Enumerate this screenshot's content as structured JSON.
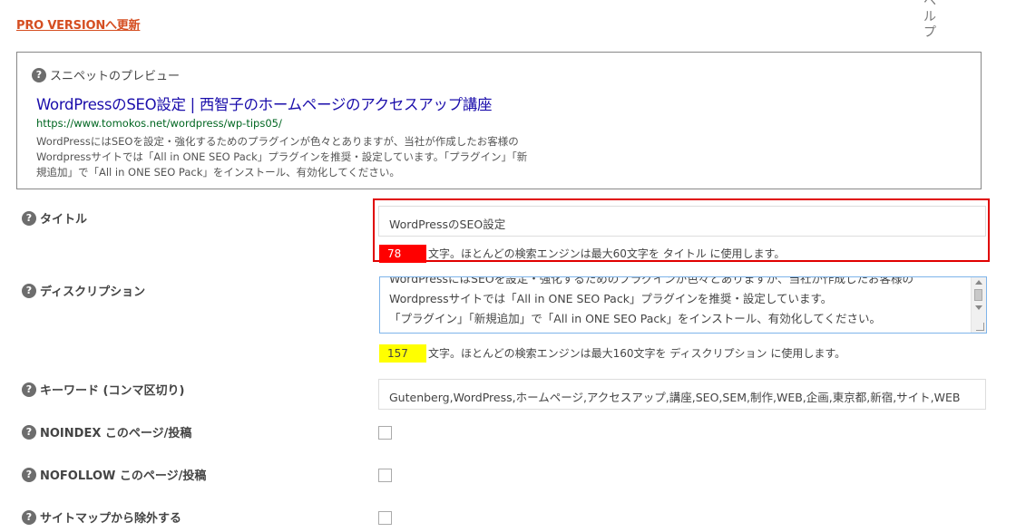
{
  "header": {
    "pro_link": "PRO VERSIONへ更新",
    "help_tab": "ヘルプ"
  },
  "snippet": {
    "heading": "スニペットのプレビュー",
    "title": "WordPressのSEO設定 | 西智子のホームページのアクセスアップ講座",
    "url": "https://www.tomokos.net/wordpress/wp-tips05/",
    "description_lines": [
      "WordPressにはSEOを設定・強化するためのプラグインが色々とありますが、当社が作成したお客様の",
      "Wordpressサイトでは「All in ONE SEO Pack」プラグインを推奨・設定しています。「プラグイン」「新",
      "規追加」で「All in ONE SEO Pack」をインストール、有効化してください。"
    ]
  },
  "fields": {
    "title": {
      "label": "タイトル",
      "value": "WordPressのSEO設定",
      "count": "78",
      "count_color": "#ff0000",
      "hint": "文字。ほとんどの検索エンジンは最大60文字を タイトル に使用します。"
    },
    "description": {
      "label": "ディスクリプション",
      "lines": [
        "WordPressにはSEOを設定・強化するためのプラグインが色々とありますが、当社が作成したお客様の",
        "Wordpressサイトでは「All in ONE SEO Pack」プラグインを推奨・設定しています。",
        "「プラグイン」「新規追加」で「All in ONE SEO Pack」をインストール、有効化してください。"
      ],
      "count": "157",
      "count_color": "#ffff00",
      "hint": "文字。ほとんどの検索エンジンは最大160文字を ディスクリプション に使用します。"
    },
    "keywords": {
      "label": "キーワード (コンマ区切り)",
      "value": "Gutenberg,WordPress,ホームページ,アクセスアップ,講座,SEO,SEM,制作,WEB,企画,東京都,新宿,サイト,WEB"
    },
    "noindex": {
      "label": "NOINDEX このページ/投稿"
    },
    "nofollow": {
      "label": "NOFOLLOW このページ/投稿"
    },
    "sitemap": {
      "label": "サイトマップから除外する"
    }
  },
  "icons": {
    "help": "question-circle-icon",
    "help_glyph": "?"
  }
}
